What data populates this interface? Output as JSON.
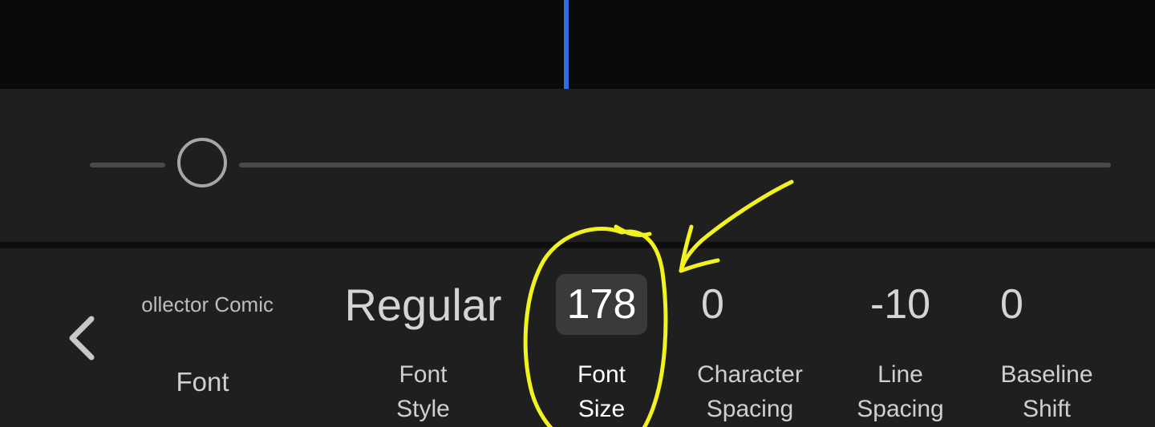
{
  "slider": {
    "value_fraction": 0.11
  },
  "properties": {
    "font": {
      "value": "ollector Comic",
      "label": "Font"
    },
    "font_style": {
      "value": "Regular",
      "label_line1": "Font",
      "label_line2": "Style"
    },
    "font_size": {
      "value": "178",
      "label_line1": "Font",
      "label_line2": "Size"
    },
    "character_spacing": {
      "value": "0",
      "label_line1": "Character",
      "label_line2": "Spacing"
    },
    "line_spacing": {
      "value": "-10",
      "label_line1": "Line",
      "label_line2": "Spacing"
    },
    "baseline_shift": {
      "value": "0",
      "label_line1": "Baseline",
      "label_line2": "Shift"
    }
  },
  "icons": {
    "back": "chevron-left-icon"
  },
  "colors": {
    "cursor": "#2f6fe0",
    "annotation": "#f2f21e",
    "panel": "#1f1f1f"
  }
}
